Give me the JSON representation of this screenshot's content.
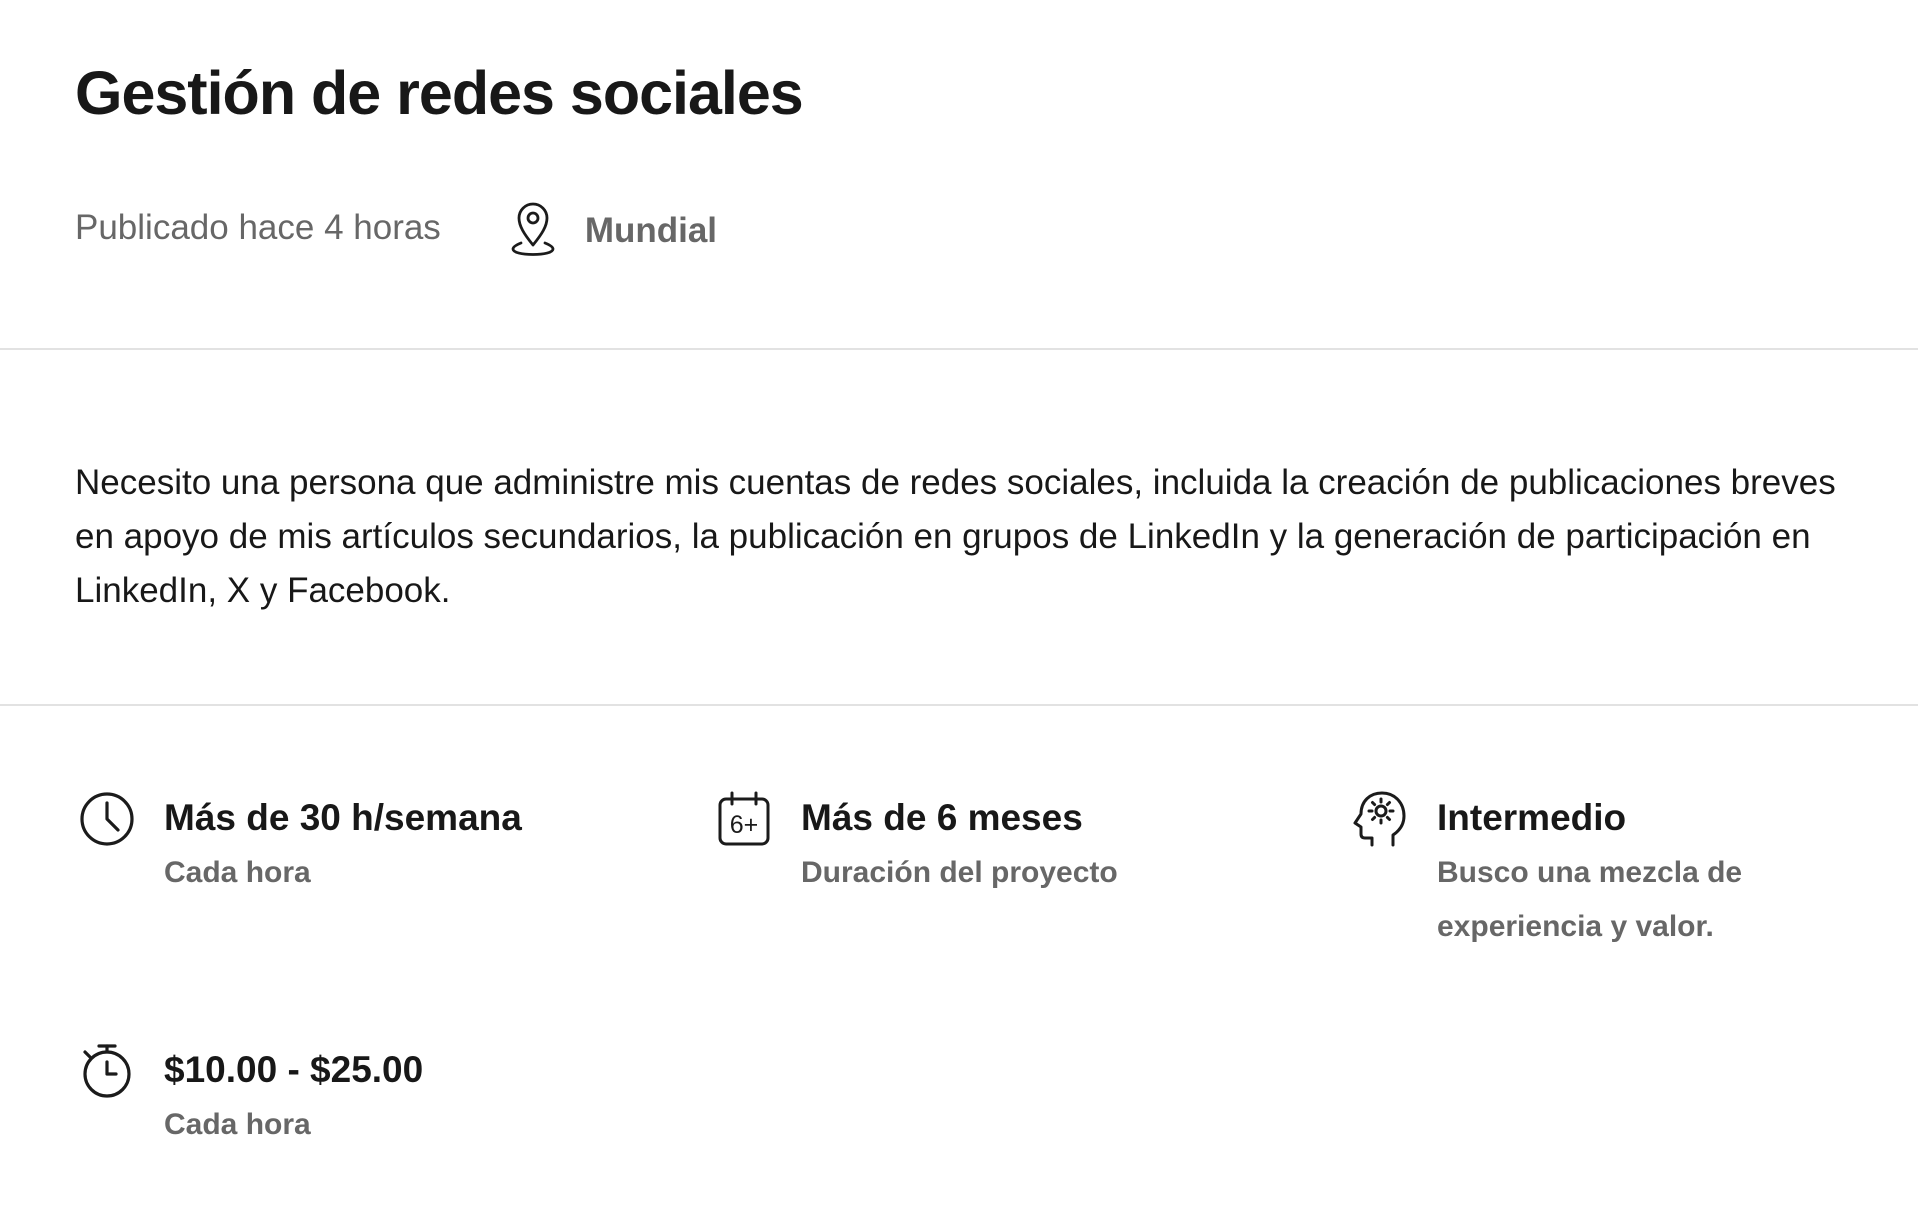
{
  "job": {
    "title": "Gestión de redes sociales",
    "posted": "Publicado hace 4 horas",
    "location": "Mundial",
    "description": "Necesito una persona que administre mis cuentas de redes sociales, incluida la creación de publicaciones breves en apoyo de mis artículos secundarios, la publicación en grupos de LinkedIn y la generación de participación en LinkedIn, X y Facebook."
  },
  "features": {
    "hours": {
      "icon": "clock-icon",
      "title": "Más de 30 h/semana",
      "subtitle": "Cada hora"
    },
    "duration": {
      "icon": "calendar-6plus-icon",
      "icon_text": "6+",
      "title": "Más de 6 meses",
      "subtitle": "Duración del proyecto"
    },
    "level": {
      "icon": "expertise-head-icon",
      "title": "Intermedio",
      "subtitle": "Busco una mezcla de experiencia y valor."
    },
    "rate": {
      "icon": "stopwatch-icon",
      "title": "$10.00 - $25.00",
      "subtitle": "Cada hora"
    }
  }
}
